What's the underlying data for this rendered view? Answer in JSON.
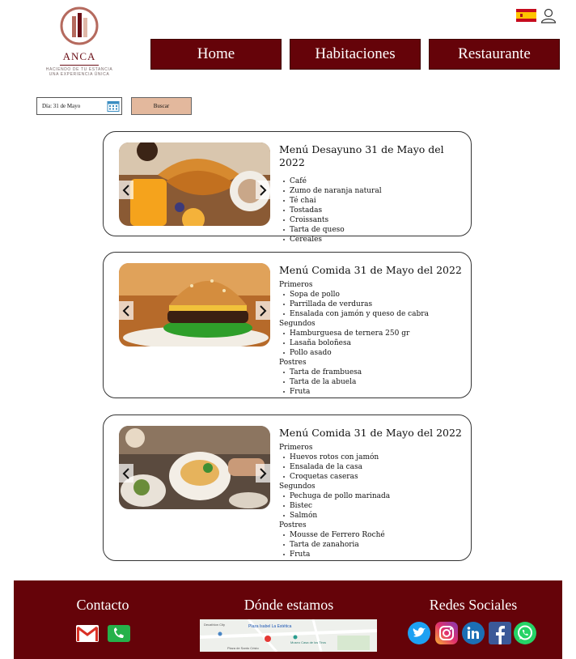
{
  "header": {
    "logo": {
      "name": "ANCA",
      "tagline_1": "HACIENDO DE TU ESTANCIA",
      "tagline_2": "UNA EXPERIENCIA ÚNICA"
    },
    "language_flag": "spain-flag-icon",
    "nav": [
      {
        "label": "Home"
      },
      {
        "label": "Habitaciones"
      },
      {
        "label": "Restaurante"
      }
    ]
  },
  "search": {
    "date_value": "Día: 31 de Mayo",
    "button_label": "Buscar"
  },
  "cards": [
    {
      "title": "Menú Desayuno 31 de Mayo del 2022",
      "items": [
        "Café",
        "Zumo de naranja natural",
        "Té chai",
        "Tostadas",
        "Croissants",
        "Tarta de queso",
        "Cereales"
      ]
    },
    {
      "title": "Menú Comida 31 de Mayo del 2022",
      "sections": [
        {
          "name": "Primeros",
          "items": [
            "Sopa de pollo",
            "Parrillada de verduras",
            "Ensalada con jamón y queso de cabra"
          ]
        },
        {
          "name": "Segundos",
          "items": [
            "Hamburguesa de ternera 250 gr",
            "Lasaña boloñesa",
            "Pollo asado"
          ]
        },
        {
          "name": "Postres",
          "items": [
            "Tarta de frambuesa",
            "Tarta de la abuela",
            "Fruta"
          ]
        }
      ]
    },
    {
      "title": "Menú Comida 31 de Mayo del 2022",
      "sections": [
        {
          "name": "Primeros",
          "items": [
            "Huevos rotos con jamón",
            "Ensalada de la casa",
            "Croquetas caseras"
          ]
        },
        {
          "name": "Segundos",
          "items": [
            "Pechuga de pollo marinada",
            "Bistec",
            "Salmón"
          ]
        },
        {
          "name": "Postres",
          "items": [
            "Mousse de Ferrero Roché",
            "Tarta de zanahoria",
            "Fruta"
          ]
        }
      ]
    }
  ],
  "footer": {
    "contact_title": "Contacto",
    "location_title": "Dónde estamos",
    "social_title": "Redes Sociales",
    "map_labels": [
      "Plaza Isabel La Estética",
      "Decathlon City",
      "Museo Casa de los Tiros",
      "Plaza de Santo Cristo"
    ],
    "colors": {
      "brand": "#650309",
      "button": "#e3b89d"
    }
  }
}
